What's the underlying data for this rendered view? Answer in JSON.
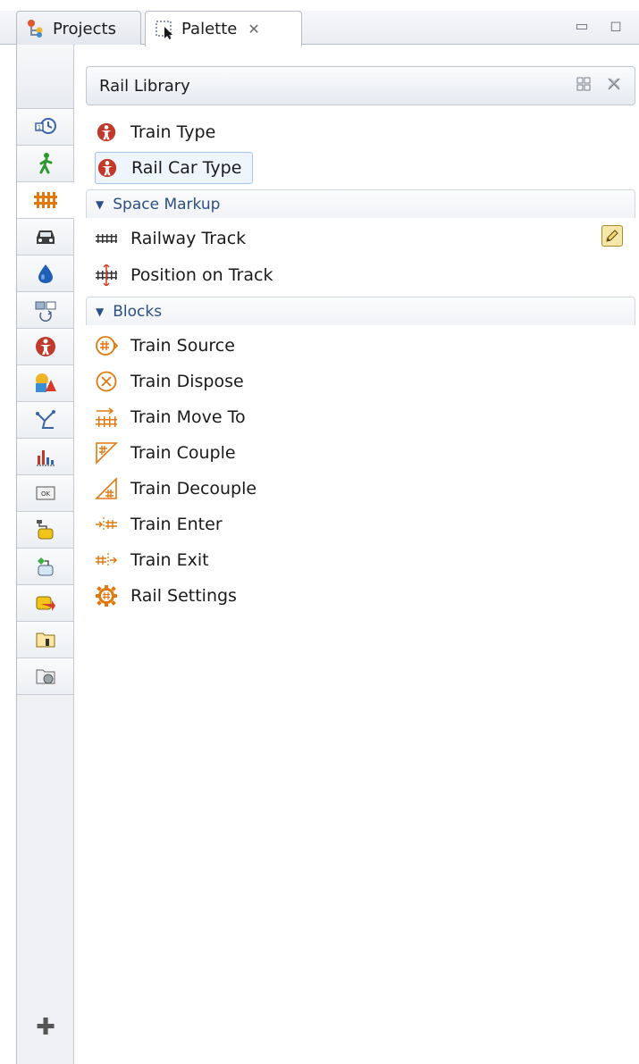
{
  "tabs": [
    {
      "label": "Projects",
      "icon": "projects-icon"
    },
    {
      "label": "Palette",
      "icon": "palette-icon",
      "close": "✕"
    }
  ],
  "window_controls": {
    "minimize": "▭",
    "maximize": "◻"
  },
  "categories": [
    {
      "icon": "process-modeling-icon"
    },
    {
      "icon": "pedestrian-icon"
    },
    {
      "icon": "rail-icon",
      "selected": true
    },
    {
      "icon": "road-traffic-icon"
    },
    {
      "icon": "fluid-icon"
    },
    {
      "icon": "material-handling-icon"
    },
    {
      "icon": "agent-icon"
    },
    {
      "icon": "presentation-icon"
    },
    {
      "icon": "space-markup-icon"
    },
    {
      "icon": "analysis-icon"
    },
    {
      "icon": "controls-icon"
    },
    {
      "icon": "connectivity-icon"
    },
    {
      "icon": "system-dynamics-icon"
    },
    {
      "icon": "statechart-icon"
    },
    {
      "icon": "actions-icon"
    },
    {
      "icon": "pictures-icon"
    }
  ],
  "add_library_label": "✚",
  "library": {
    "title": "Rail Library",
    "top_items": [
      {
        "label": "Train Type",
        "icon": "agent-type-icon"
      },
      {
        "label": "Rail Car Type",
        "icon": "agent-type-icon",
        "selected": true
      }
    ],
    "sections": [
      {
        "title": "Space Markup",
        "items": [
          {
            "label": "Railway Track",
            "icon": "railway-track-icon"
          },
          {
            "label": "Position on Track",
            "icon": "position-on-track-icon"
          }
        ]
      },
      {
        "title": "Blocks",
        "items": [
          {
            "label": "Train Source",
            "icon": "train-source-icon"
          },
          {
            "label": "Train Dispose",
            "icon": "train-dispose-icon"
          },
          {
            "label": "Train Move To",
            "icon": "train-move-to-icon"
          },
          {
            "label": "Train Couple",
            "icon": "train-couple-icon"
          },
          {
            "label": "Train Decouple",
            "icon": "train-decouple-icon"
          },
          {
            "label": "Train Enter",
            "icon": "train-enter-icon"
          },
          {
            "label": "Train Exit",
            "icon": "train-exit-icon"
          },
          {
            "label": "Rail Settings",
            "icon": "rail-settings-icon"
          }
        ]
      }
    ]
  },
  "colors": {
    "accent": "#2b4f86",
    "rail_orange": "#e07a10",
    "agent_red": "#c0392b"
  }
}
